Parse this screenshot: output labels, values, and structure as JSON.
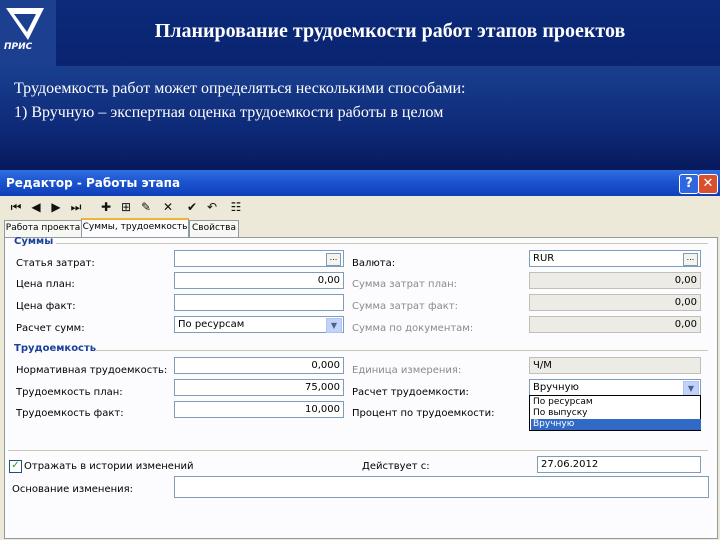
{
  "slide": {
    "title": "Планирование трудоемкости работ этапов проектов",
    "logo_text": "ПРИС",
    "lines": [
      "Трудоемкость работ может определяться несколькими способами:",
      "1)  Вручную – экспертная оценка трудоемкости работы в целом"
    ]
  },
  "window": {
    "title": "Редактор - Работы этапа",
    "help_label": "?",
    "close_label": "✕"
  },
  "toolbar": {
    "icons": [
      "first-icon",
      "prev-icon",
      "next-icon",
      "last-icon",
      "add-icon",
      "add-box-icon",
      "edit-icon",
      "delete-icon",
      "check-icon",
      "undo-icon",
      "properties-icon"
    ]
  },
  "tabs": [
    "Работа проекта",
    "Суммы, трудоемкость",
    "Свойства"
  ],
  "sums": {
    "group_title": "Суммы",
    "cost_item_label": "Статья затрат:",
    "cost_item_value": "",
    "price_plan_label": "Цена план:",
    "price_plan_value": "0,00",
    "price_fact_label": "Цена факт:",
    "price_fact_value": "",
    "calc_label": "Расчет сумм:",
    "calc_value": "По ресурсам",
    "currency_label": "Валюта:",
    "currency_value": "RUR",
    "sum_plan_label": "Сумма затрат план:",
    "sum_plan_value": "0,00",
    "sum_fact_label": "Сумма затрат факт:",
    "sum_fact_value": "0,00",
    "sum_doc_label": "Сумма по документам:",
    "sum_doc_value": "0,00"
  },
  "labor": {
    "group_title": "Трудоемкость",
    "norm_label": "Нормативная трудоемкость:",
    "norm_value": "0,000",
    "plan_label": "Трудоемкость план:",
    "plan_value": "75,000",
    "fact_label": "Трудоемкость факт:",
    "fact_value": "10,000",
    "unit_label": "Единица измерения:",
    "unit_value": "Ч/М",
    "calc_label": "Расчет трудоемкости:",
    "calc_value": "Вручную",
    "percent_label": "Процент по трудоемкости:",
    "options": [
      "По ресурсам",
      "По выпуску",
      "Вручную"
    ]
  },
  "footer": {
    "history_label": "Отражать в истории изменений",
    "history_checked": true,
    "effective_label": "Действует с:",
    "effective_value": "27.06.2012",
    "reason_label": "Основание изменения:",
    "reason_value": ""
  }
}
